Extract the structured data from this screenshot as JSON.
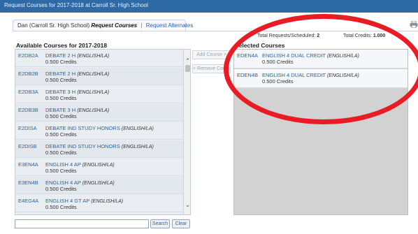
{
  "window": {
    "title": "Request Courses for 2017-2018 at Carroll Sr. High School"
  },
  "tabs": {
    "student": "Dan (Carroll Sr. High School)",
    "active": "Request Courses",
    "separator": "|",
    "alternates": "Request Alternates"
  },
  "totals": {
    "requests_label": "Total Requests/Scheduled:",
    "requests_value": "2",
    "credits_label": "Total Credits:",
    "credits_value": "1.000"
  },
  "available": {
    "title": "Available Courses for 2017-2018",
    "courses": [
      {
        "code": "E2DB2A",
        "name": "DEBATE 2 H",
        "dept": "(ENGLISH/LA)",
        "credits": "0.500 Credits"
      },
      {
        "code": "E2DB2B",
        "name": "DEBATE 2 H",
        "dept": "(ENGLISH/LA)",
        "credits": "0.500 Credits"
      },
      {
        "code": "E2DB3A",
        "name": "DEBATE 3 H",
        "dept": "(ENGLISH/LA)",
        "credits": "0.500 Credits"
      },
      {
        "code": "E2DB3B",
        "name": "DEBATE 3 H",
        "dept": "(ENGLISH/LA)",
        "credits": "0.500 Credits"
      },
      {
        "code": "E2DISA",
        "name": "DEBATE IND STUDY HONORS",
        "dept": "(ENGLISH/LA)",
        "credits": "0.500 Credits"
      },
      {
        "code": "E2DISB",
        "name": "DEBATE IND STUDY HONORS",
        "dept": "(ENGLISH/LA)",
        "credits": "0.500 Credits"
      },
      {
        "code": "E3EN4A",
        "name": "ENGLISH 4 AP",
        "dept": "(ENGLISH/LA)",
        "credits": "0.500 Credits"
      },
      {
        "code": "E3EN4B",
        "name": "ENGLISH 4 AP",
        "dept": "(ENGLISH/LA)",
        "credits": "0.500 Credits"
      },
      {
        "code": "E4EG4A",
        "name": "ENGLISH 4 GT AP",
        "dept": "(ENGLISH/LA)",
        "credits": "0.500 Credits"
      }
    ]
  },
  "actions": {
    "add": "Add Course >",
    "remove": "< Remove Course"
  },
  "selected": {
    "title": "Selected Courses",
    "courses": [
      {
        "code": "EDEN4A",
        "name": "ENGLISH 4 DUAL CREDIT",
        "dept": "(ENGLISH/LA)",
        "credits": "0.500 Credits"
      },
      {
        "code": "EDEN4B",
        "name": "ENGLISH 4 DUAL CREDIT",
        "dept": "(ENGLISH/LA)",
        "credits": "0.500 Credits"
      }
    ]
  },
  "search": {
    "value": "",
    "button": "Search",
    "clear": "Clear"
  },
  "icons": {
    "printer": "printer-icon",
    "scroll_up": "chevron-up-icon",
    "scroll_down": "chevron-down-icon"
  },
  "colors": {
    "titlebar": "#2d6aa6",
    "link": "#2a62a8",
    "annotation": "#e81c24"
  }
}
